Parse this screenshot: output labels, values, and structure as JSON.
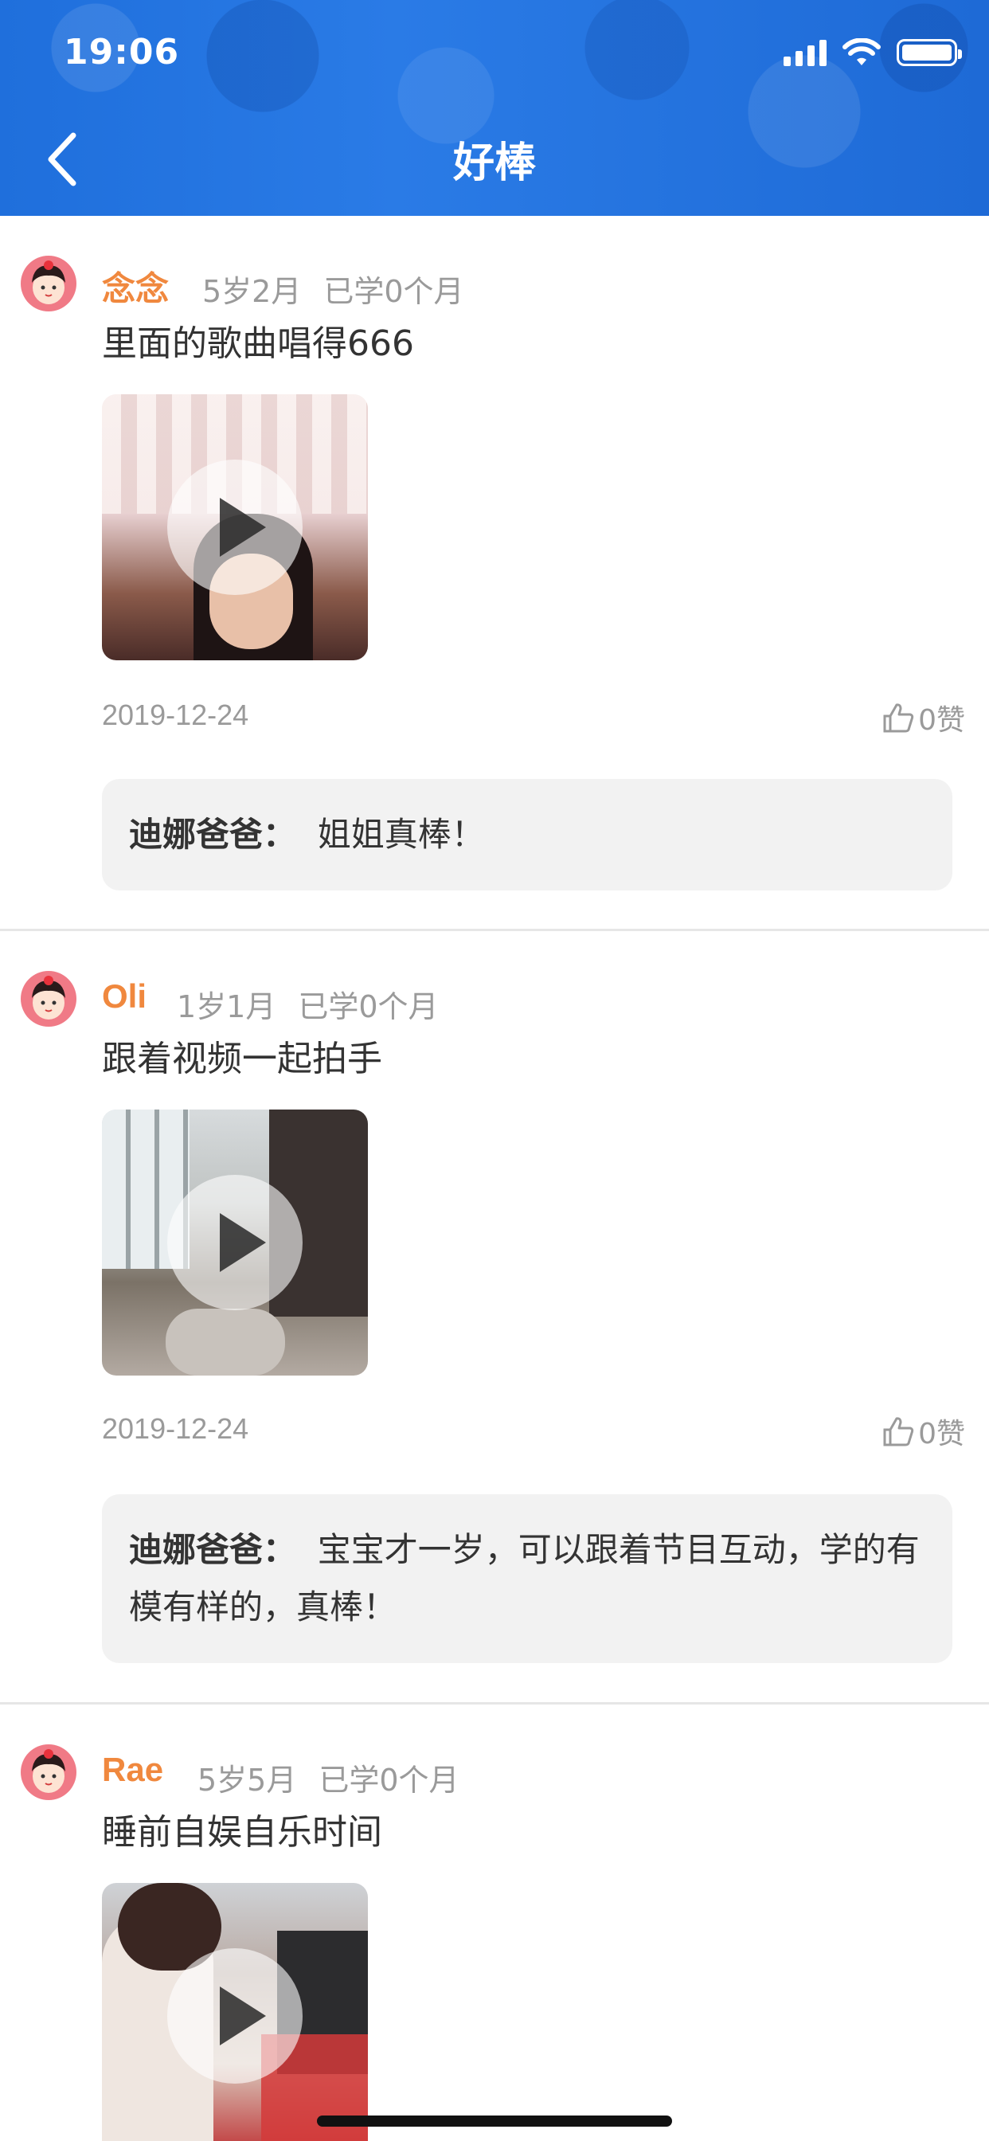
{
  "status_bar": {
    "time": "19:06"
  },
  "header": {
    "title": "好棒"
  },
  "posts": [
    {
      "name": "念念",
      "age": "5岁2月",
      "learned": "已学0个月",
      "caption": "里面的歌曲唱得666",
      "date": "2019-12-24",
      "likes": "0赞",
      "reply": {
        "author": "迪娜爸爸：",
        "text": "姐姐真棒！"
      }
    },
    {
      "name": "Oli",
      "age": "1岁1月",
      "learned": "已学0个月",
      "caption": "跟着视频一起拍手",
      "date": "2019-12-24",
      "likes": "0赞",
      "reply": {
        "author": "迪娜爸爸：",
        "text": "宝宝才一岁，可以跟着节目互动，学的有模有样的，真棒！"
      }
    },
    {
      "name": "Rae",
      "age": "5岁5月",
      "learned": "已学0个月",
      "caption": "睡前自娱自乐时间"
    }
  ]
}
